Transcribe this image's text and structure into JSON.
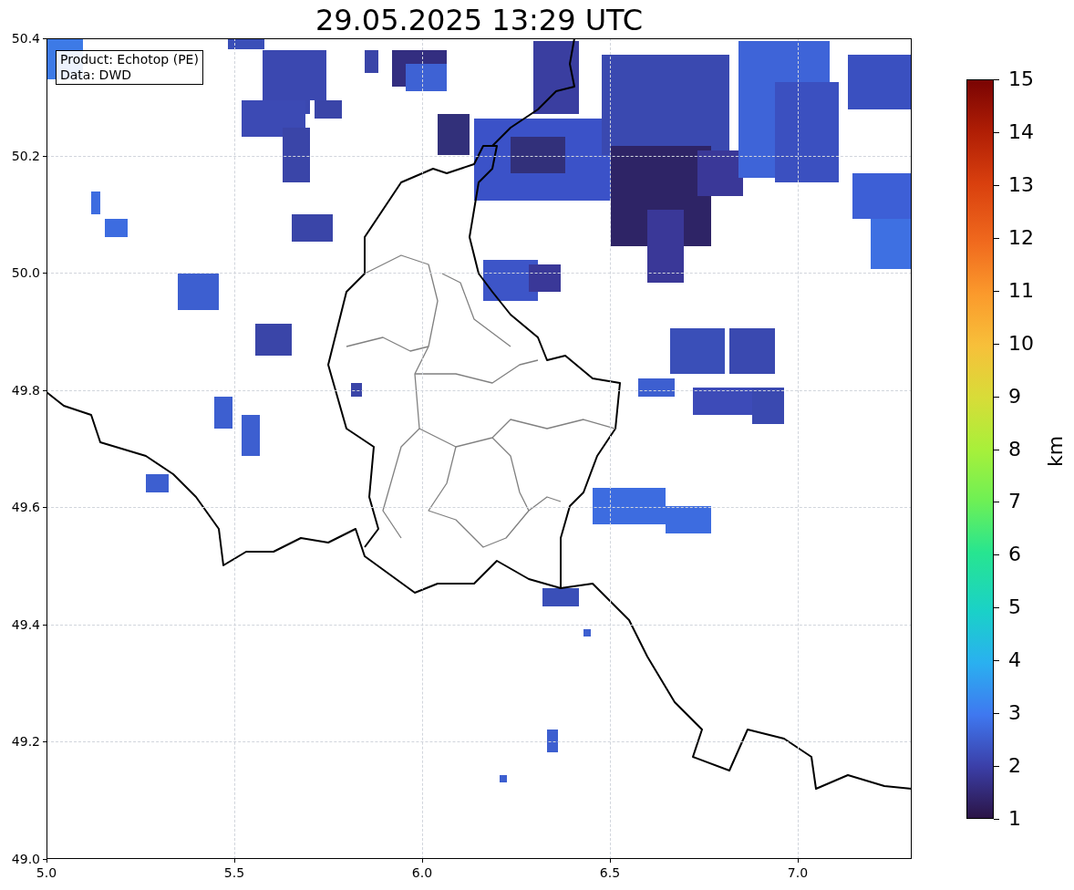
{
  "title": "29.05.2025 13:29 UTC",
  "info_box": [
    "Product: Echotop (PE)",
    "Data: DWD"
  ],
  "x_ticks": [
    "5.0",
    "5.5",
    "6.0",
    "6.5",
    "7.0"
  ],
  "y_ticks": [
    "50.4",
    "50.2",
    "50.0",
    "49.8",
    "49.6",
    "49.4",
    "49.2",
    "49.0"
  ],
  "colorbar": {
    "label": "km",
    "ticks": [
      "15",
      "14",
      "13",
      "12",
      "11",
      "10",
      "9",
      "8",
      "7",
      "6",
      "5",
      "4",
      "3",
      "2",
      "1"
    ]
  }
}
